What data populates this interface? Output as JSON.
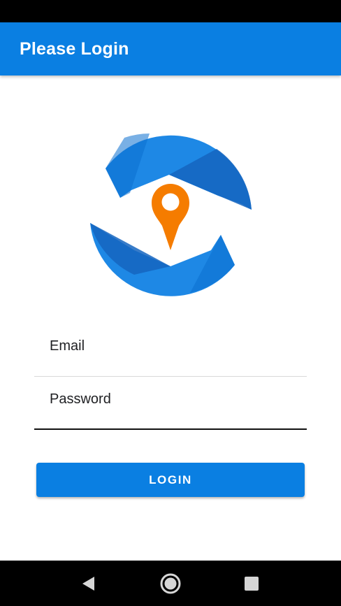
{
  "app_bar": {
    "title": "Please Login"
  },
  "logo": {
    "icon": "location-pin-refresh-logo",
    "colors": {
      "ring": "#1e88e5",
      "ring_dark": "#1565c0",
      "pin": "#f57c00"
    }
  },
  "form": {
    "email": {
      "placeholder": "Email",
      "value": ""
    },
    "password": {
      "placeholder": "Password",
      "value": ""
    },
    "login_label": "LOGIN"
  },
  "nav_bar": {
    "buttons": [
      "back-icon",
      "home-icon",
      "recents-icon"
    ]
  },
  "colors": {
    "primary": "#0a7fe2",
    "text": "#202124"
  }
}
